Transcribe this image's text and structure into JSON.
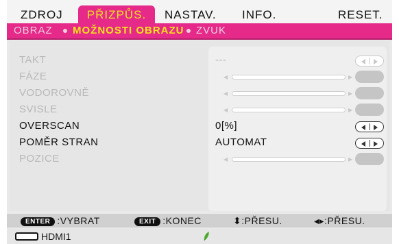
{
  "tabs": [
    {
      "label": "ZDROJ"
    },
    {
      "label": "PŘIZPŮS."
    },
    {
      "label": "NASTAV."
    },
    {
      "label": "INFO."
    },
    {
      "label": "RESET."
    }
  ],
  "subnav": {
    "items": [
      {
        "label": "OBRAZ"
      },
      {
        "label": "MOŽNOSTI OBRAZU"
      },
      {
        "label": "ZVUK"
      }
    ]
  },
  "menu": {
    "items": [
      {
        "label": "TAKT",
        "value": "---"
      },
      {
        "label": "FÁZE"
      },
      {
        "label": "VODOROVNĚ"
      },
      {
        "label": "SVISLE"
      },
      {
        "label": "OVERSCAN",
        "value": "0[%]"
      },
      {
        "label": "POMĚR STRAN",
        "value": "AUTOMAT"
      },
      {
        "label": "POZICE"
      }
    ]
  },
  "hints": {
    "enter_key": "ENTER",
    "enter_text": ":VYBRAT",
    "exit_key": "EXIT",
    "exit_text": ":KONEC",
    "updown_text": "⬍:PŘESU.",
    "leftright_text": "◂▸:PŘESU."
  },
  "status": {
    "input": "HDMI1"
  },
  "colors": {
    "accent": "#e62a8a",
    "highlight_text": "#f7e21a"
  }
}
